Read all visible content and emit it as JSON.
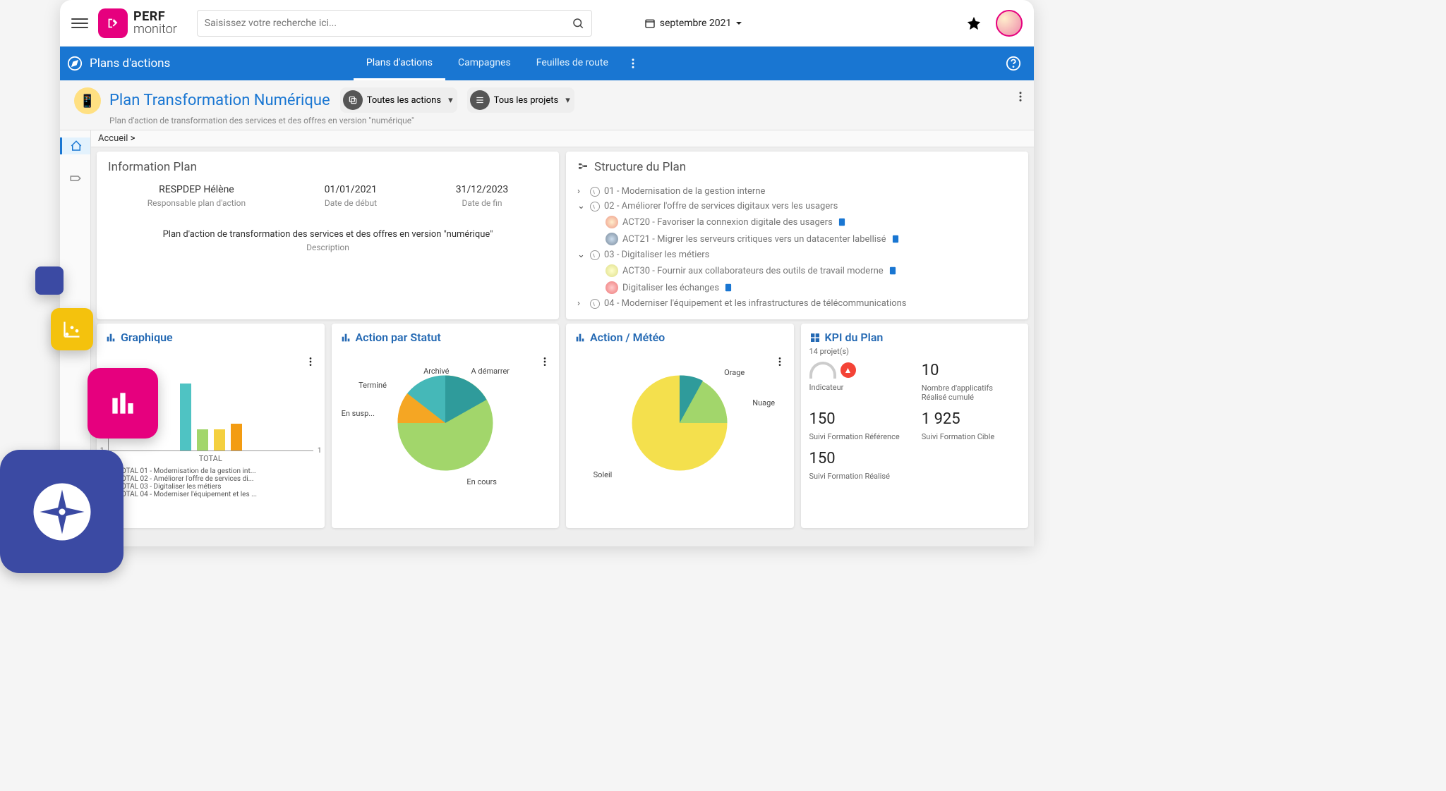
{
  "logo": {
    "line1": "PERF",
    "line2": "monitor"
  },
  "search": {
    "placeholder": "Saisissez votre recherche ici..."
  },
  "date_selector": {
    "label": "septembre 2021"
  },
  "navbar": {
    "title": "Plans d'actions",
    "tabs": [
      "Plans d'actions",
      "Campagnes",
      "Feuilles de route"
    ]
  },
  "plan": {
    "title": "Plan Transformation Numérique",
    "subtitle": "Plan d'action de transformation des services et des offres en version \"numérique\"",
    "filter1": "Toutes les actions",
    "filter2": "Tous les projets"
  },
  "breadcrumb": {
    "home": "Accueil",
    "sep": " >"
  },
  "info_panel": {
    "title": "Information Plan",
    "responsible": {
      "value": "RESPDEP Hélène",
      "label": "Responsable plan d'action"
    },
    "start": {
      "value": "01/01/2021",
      "label": "Date de début"
    },
    "end": {
      "value": "31/12/2023",
      "label": "Date de fin"
    },
    "description": {
      "value": "Plan d'action de transformation des services et des offres en version \"numérique\"",
      "label": "Description"
    }
  },
  "structure_panel": {
    "title": "Structure du Plan",
    "items": [
      {
        "code": "01",
        "label": "01 - Modernisation de la gestion interne"
      },
      {
        "code": "02",
        "label": "02 - Améliorer l'offre de services digitaux vers les usagers"
      },
      {
        "code": "ACT20",
        "label": "ACT20 - Favoriser la connexion digitale des usagers"
      },
      {
        "code": "ACT21",
        "label": "ACT21 - Migrer les serveurs critiques vers un datacenter labellisé"
      },
      {
        "code": "03",
        "label": "03 - Digitaliser les métiers"
      },
      {
        "code": "ACT30",
        "label": "ACT30 - Fournir aux collaborateurs des outils de travail moderne"
      },
      {
        "code": "DIG",
        "label": "Digitaliser les échanges"
      },
      {
        "code": "04",
        "label": "04 - Moderniser l'équipement et les infrastructures de télécommunications"
      }
    ]
  },
  "cards": {
    "graphique": {
      "title": "Graphique",
      "xaxis_label": "TOTAL",
      "axis_min": "-1",
      "axis_max": "1",
      "legend": {
        "0": "TOTAL 01 - Modernisation de la gestion int...",
        "1": "TOTAL 02 - Améliorer l'offre de services di...",
        "2": "TOTAL 03 - Digitaliser les métiers",
        "3": "TOTAL 04 - Moderniser l'équipement et les ..."
      }
    },
    "statut": {
      "title": "Action par Statut",
      "labels": {
        "archive": "Archivé",
        "ademarrer": "A démarrer",
        "termine": "Terminé",
        "encours": "En cours",
        "ensusp": "En susp..."
      }
    },
    "meteo": {
      "title": "Action / Météo",
      "labels": {
        "orage": "Orage",
        "nuage": "Nuage",
        "soleil": "Soleil"
      }
    },
    "kpi": {
      "title": "KPI du Plan",
      "projects": "14 projet(s)",
      "cells": {
        "0": {
          "big": "10",
          "lbl": "Nombre d'applicatifs Réalisé cumulé"
        },
        "1": {
          "big": "",
          "lbl": "Indicateur"
        },
        "2": {
          "big": "150",
          "lbl": "Suivi Formation Référence"
        },
        "3": {
          "big": "1 925",
          "lbl": "Suivi Formation Cible"
        },
        "4": {
          "big": "150",
          "lbl": "Suivi Formation Réalisé"
        }
      }
    }
  },
  "chart_data": [
    {
      "type": "bar",
      "title": "Graphique",
      "categories": [
        "TOTAL"
      ],
      "ylim": [
        -1,
        3
      ],
      "series": [
        {
          "name": "TOTAL 01 - Modernisation de la gestion interne",
          "values": [
            3
          ],
          "color": "#4fc3c3"
        },
        {
          "name": "TOTAL 02 - Améliorer l'offre de services digitaux",
          "values": [
            1
          ],
          "color": "#a2d66b"
        },
        {
          "name": "TOTAL 03 - Digitaliser les métiers",
          "values": [
            1
          ],
          "color": "#f4d03f"
        },
        {
          "name": "TOTAL 04 - Moderniser l'équipement et les infrastructures",
          "values": [
            1.2
          ],
          "color": "#f39c12"
        }
      ]
    },
    {
      "type": "pie",
      "title": "Action par Statut",
      "categories": [
        "En cours",
        "Terminé",
        "Archivé",
        "A démarrer",
        "En susp..."
      ],
      "values": [
        55,
        20,
        10,
        12,
        3
      ],
      "colors": [
        "#a2d66b",
        "#f5a623",
        "#45b8b8",
        "#2f9b9b",
        "#2f9b9b"
      ]
    },
    {
      "type": "pie",
      "title": "Action / Météo",
      "categories": [
        "Soleil",
        "Nuage",
        "Orage"
      ],
      "values": [
        70,
        22,
        8
      ],
      "colors": [
        "#f4e04d",
        "#a2d66b",
        "#2f9b9b"
      ]
    }
  ]
}
